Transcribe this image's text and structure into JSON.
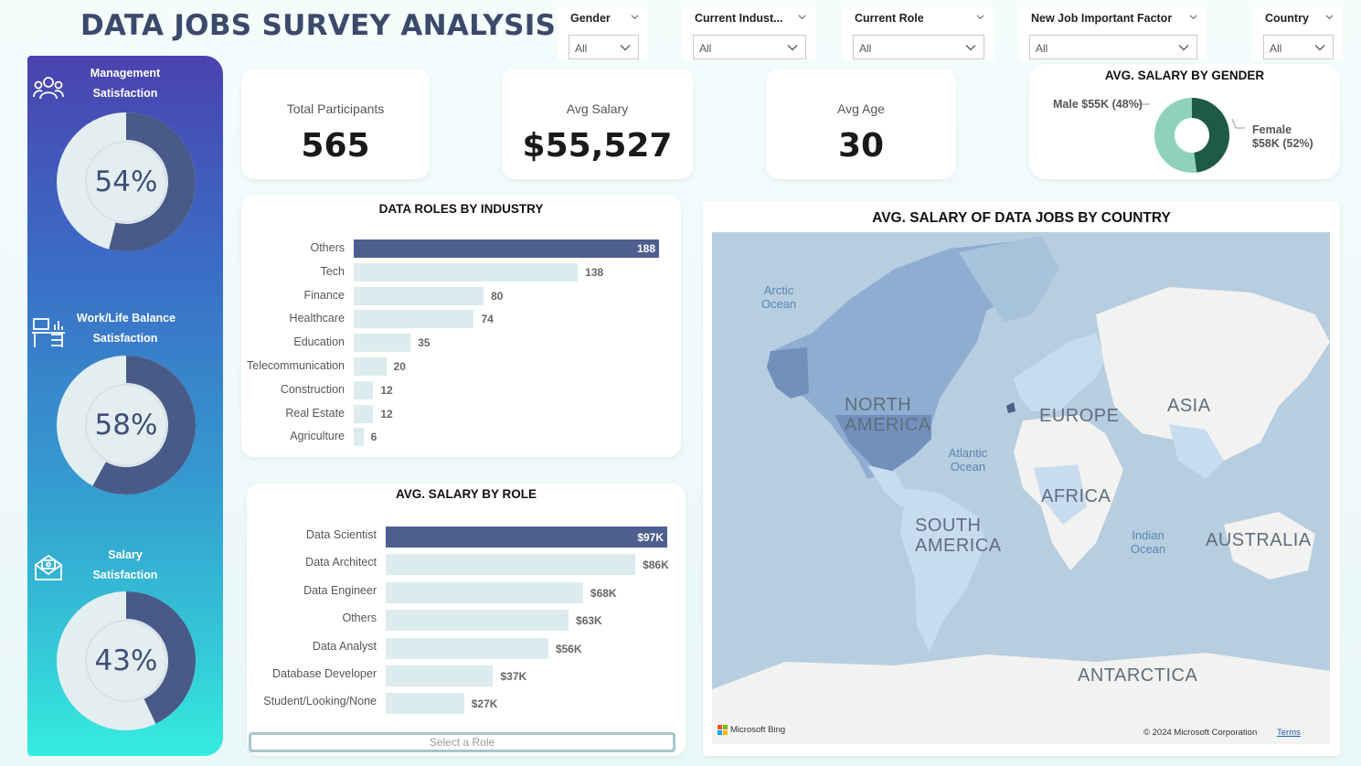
{
  "title": "DATA JOBS SURVEY ANALYSIS",
  "colors": {
    "dark_bar": "#4e5f8f",
    "light_bar": "#dcebed",
    "donut_fill": "#4a5a88",
    "donut_bg": "#e3eef1",
    "male": "#1e5b45",
    "female": "#8fd2bb"
  },
  "slicers": [
    {
      "label": "Gender",
      "value": "All"
    },
    {
      "label": "Current Indust...",
      "value": "All"
    },
    {
      "label": "Current Role",
      "value": "All"
    },
    {
      "label": "New Job Important Factor",
      "value": "All"
    },
    {
      "label": "Country",
      "value": "All"
    }
  ],
  "side": {
    "items": [
      {
        "label_1": "Management",
        "label_2": "Satisfaction",
        "icon": "people-icon",
        "percent": "54%",
        "value": 0.54
      },
      {
        "label_1": "Work/Life Balance",
        "label_2": "Satisfaction",
        "icon": "desk-icon",
        "percent": "58%",
        "value": 0.58
      },
      {
        "label_1": "Salary",
        "label_2": "Satisfaction",
        "icon": "money-envelope-icon",
        "percent": "43%",
        "value": 0.43
      }
    ]
  },
  "kpis": [
    {
      "label": "Total Participants",
      "value": "565"
    },
    {
      "label": "Avg Salary",
      "value": "$55,527"
    },
    {
      "label": "Avg Age",
      "value": "30"
    }
  ],
  "gender_card": {
    "title": "AVG. SALARY BY GENDER",
    "male_label": "Male $55K (48%)",
    "female_label_1": "Female",
    "female_label_2": "$58K (52%)"
  },
  "industry_card": {
    "title": "DATA ROLES BY INDUSTRY"
  },
  "role_card": {
    "title": "AVG. SALARY BY ROLE",
    "select_label": "Select a Role"
  },
  "map_card": {
    "title": "AVG. SALARY OF DATA JOBS BY COUNTRY",
    "continents": [
      "NORTH AMERICA",
      "EUROPE",
      "ASIA",
      "AFRICA",
      "SOUTH AMERICA",
      "AUSTRALIA",
      "ANTARCTICA"
    ],
    "oceans": [
      "Arctic Ocean",
      "Atlantic Ocean",
      "Indian Ocean"
    ],
    "provider": "Microsoft Bing",
    "copyright": "© 2024 Microsoft Corporation",
    "terms": "Terms"
  },
  "chart_data": [
    {
      "type": "bar",
      "title": "DATA ROLES BY INDUSTRY",
      "categories": [
        "Others",
        "Tech",
        "Finance",
        "Healthcare",
        "Education",
        "Telecommunication",
        "Construction",
        "Real Estate",
        "Agriculture"
      ],
      "values": [
        188,
        138,
        80,
        74,
        35,
        20,
        12,
        12,
        6
      ],
      "labels": [
        "188",
        "138",
        "80",
        "74",
        "35",
        "20",
        "12",
        "12",
        "6"
      ],
      "orientation": "horizontal",
      "xlim": [
        0,
        188
      ]
    },
    {
      "type": "bar",
      "title": "AVG. SALARY BY ROLE",
      "categories": [
        "Data Scientist",
        "Data Architect",
        "Data Engineer",
        "Others",
        "Data Analyst",
        "Database Developer",
        "Student/Looking/None"
      ],
      "values": [
        97,
        86,
        68,
        63,
        56,
        37,
        27
      ],
      "labels": [
        "$97K",
        "$86K",
        "$68K",
        "$63K",
        "$56K",
        "$37K",
        "$27K"
      ],
      "orientation": "horizontal",
      "unit": "$K",
      "xlim": [
        0,
        97
      ]
    },
    {
      "type": "pie",
      "title": "AVG. SALARY BY GENDER",
      "categories": [
        "Male",
        "Female"
      ],
      "values": [
        55,
        58
      ],
      "shares": [
        0.48,
        0.52
      ]
    }
  ]
}
